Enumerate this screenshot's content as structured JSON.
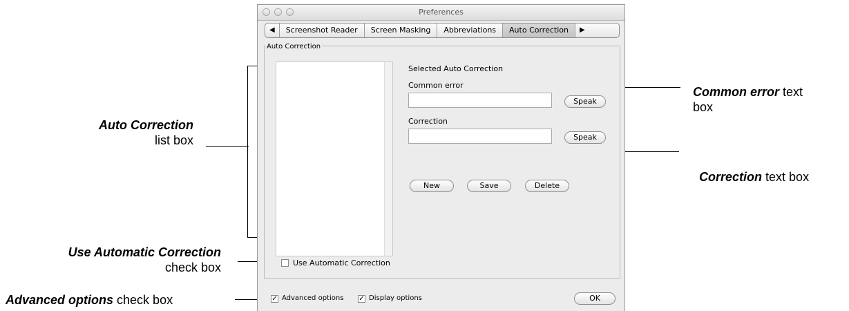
{
  "window": {
    "title": "Preferences"
  },
  "tabs": {
    "left_arrow": "◀",
    "right_arrow": "▶",
    "items": [
      "Screenshot Reader",
      "Screen Masking",
      "Abbreviations",
      "Auto Correction"
    ]
  },
  "group": {
    "label": "Auto Correction"
  },
  "form": {
    "selected_heading": "Selected Auto Correction",
    "common_error_label": "Common error",
    "common_error_value": "",
    "correction_label": "Correction",
    "correction_value": "",
    "speak_label": "Speak",
    "new_label": "New",
    "save_label": "Save",
    "delete_label": "Delete"
  },
  "checkboxes": {
    "use_auto_correction": {
      "label": "Use Automatic Correction",
      "checked": false
    },
    "advanced_options": {
      "label": "Advanced options",
      "checked": true
    },
    "display_options": {
      "label": "Display options",
      "checked": true
    }
  },
  "ok_label": "OK",
  "callouts": {
    "auto_list_bold": "Auto Correction",
    "auto_list_rest": "list box",
    "use_auto_bold": "Use Automatic Correction",
    "use_auto_rest": "check box",
    "advanced_bold": "Advanced options",
    "advanced_rest": "check box",
    "common_error_bold": "Common error",
    "common_error_rest1": "text",
    "common_error_rest2": "box",
    "correction_bold": "Correction",
    "correction_rest": "text box"
  }
}
